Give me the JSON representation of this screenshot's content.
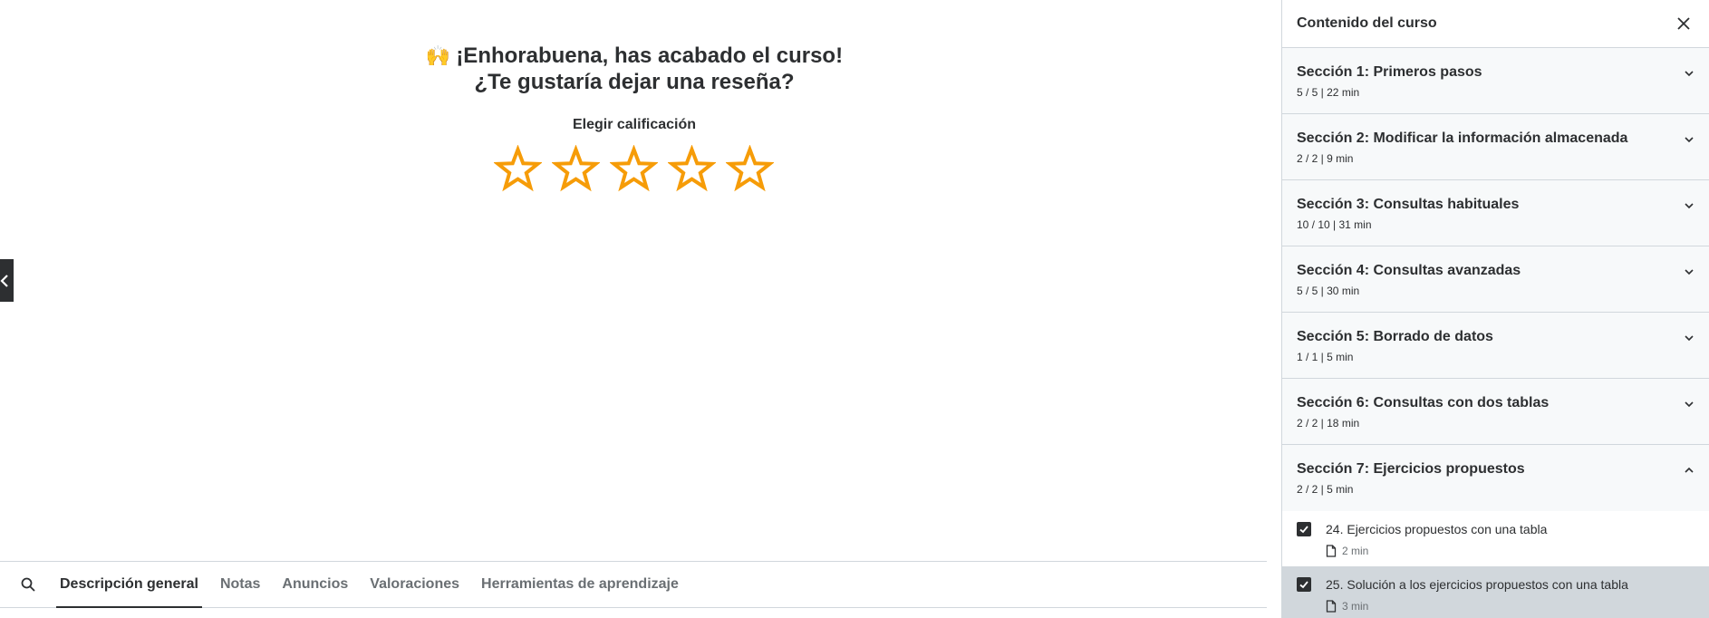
{
  "review": {
    "emoji": "🙌",
    "headline_line1": "¡Enhorabuena, has acabado el curso!",
    "headline_line2": "¿Te gustaría dejar una reseña?",
    "rating_label": "Elegir calificación",
    "star_count": 5,
    "star_color": "#f69c08"
  },
  "tabs": {
    "search_icon": "search-icon",
    "items": [
      {
        "label": "Descripción general",
        "active": true
      },
      {
        "label": "Notas",
        "active": false
      },
      {
        "label": "Anuncios",
        "active": false
      },
      {
        "label": "Valoraciones",
        "active": false
      },
      {
        "label": "Herramientas de aprendizaje",
        "active": false
      }
    ]
  },
  "sidebar": {
    "title": "Contenido del curso",
    "close_icon": "close-icon",
    "sections": [
      {
        "title": "Sección 1: Primeros pasos",
        "meta": "5 / 5 | 22 min",
        "expanded": false
      },
      {
        "title": "Sección 2: Modificar la información almacenada",
        "meta": "2 / 2 | 9 min",
        "expanded": false
      },
      {
        "title": "Sección 3: Consultas habituales",
        "meta": "10 / 10 | 31 min",
        "expanded": false
      },
      {
        "title": "Sección 4: Consultas avanzadas",
        "meta": "5 / 5 | 30 min",
        "expanded": false
      },
      {
        "title": "Sección 5: Borrado de datos",
        "meta": "1 / 1 | 5 min",
        "expanded": false
      },
      {
        "title": "Sección 6: Consultas con dos tablas",
        "meta": "2 / 2 | 18 min",
        "expanded": false
      },
      {
        "title": "Sección 7: Ejercicios propuestos",
        "meta": "2 / 2 | 5 min",
        "expanded": true
      }
    ],
    "lectures": [
      {
        "title": "24. Ejercicios propuestos con una tabla",
        "duration": "2 min",
        "completed": true,
        "current": false
      },
      {
        "title": "25. Solución a los ejercicios propuestos con una tabla",
        "duration": "3 min",
        "completed": true,
        "current": true
      }
    ]
  },
  "colors": {
    "text": "#2d2f31",
    "muted": "#6a6f73",
    "border": "#d1d7dc",
    "section_bg": "#f7f9fa",
    "star": "#f69c08"
  }
}
